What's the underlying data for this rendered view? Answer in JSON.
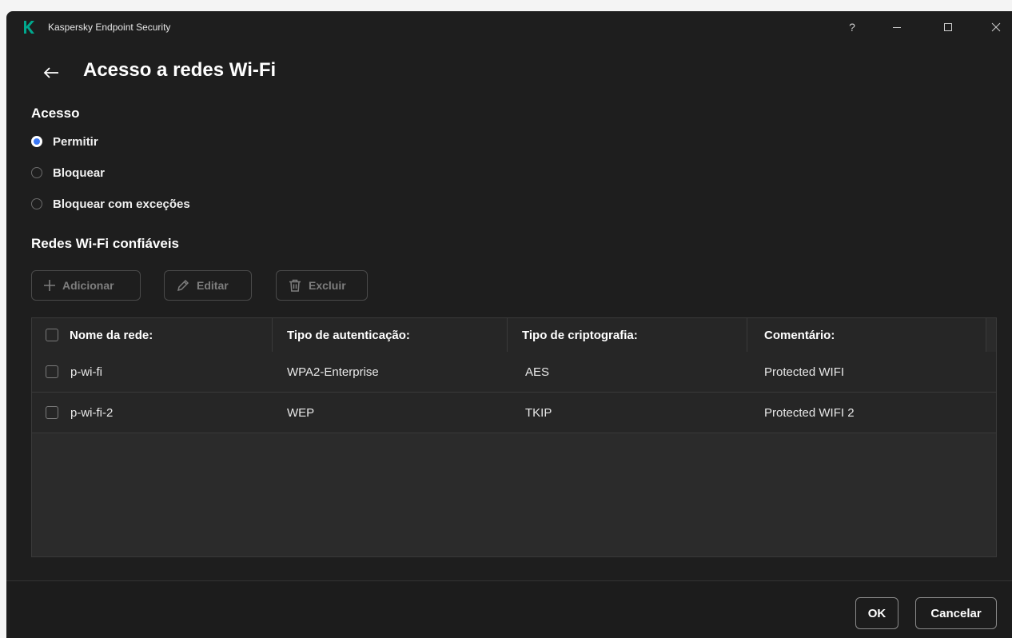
{
  "window": {
    "title": "Kaspersky Endpoint Security",
    "help_symbol": "?"
  },
  "page": {
    "title": "Acesso a redes Wi-Fi"
  },
  "access": {
    "label": "Acesso",
    "options": [
      {
        "label": "Permitir",
        "checked": true
      },
      {
        "label": "Bloquear",
        "checked": false
      },
      {
        "label": "Bloquear com exceções",
        "checked": false
      }
    ]
  },
  "trusted": {
    "label": "Redes Wi-Fi confiáveis",
    "toolbar": {
      "add_label": "Adicionar",
      "edit_label": "Editar",
      "delete_label": "Excluir"
    },
    "columns": [
      "Nome da rede:",
      "Tipo de autenticação:",
      "Tipo de criptografia:",
      "Comentário:"
    ],
    "rows": [
      {
        "name": "p-wi-fi",
        "auth": "WPA2-Enterprise",
        "encryption": "AES",
        "comment": "Protected WIFI"
      },
      {
        "name": "p-wi-fi-2",
        "auth": "WEP",
        "encryption": "TKIP",
        "comment": "Protected WIFI 2"
      }
    ]
  },
  "footer": {
    "ok_label": "OK",
    "cancel_label": "Cancelar"
  },
  "colors": {
    "accent": "#3b78f6",
    "brand": "#00a88e",
    "background": "#1e1e1e"
  }
}
